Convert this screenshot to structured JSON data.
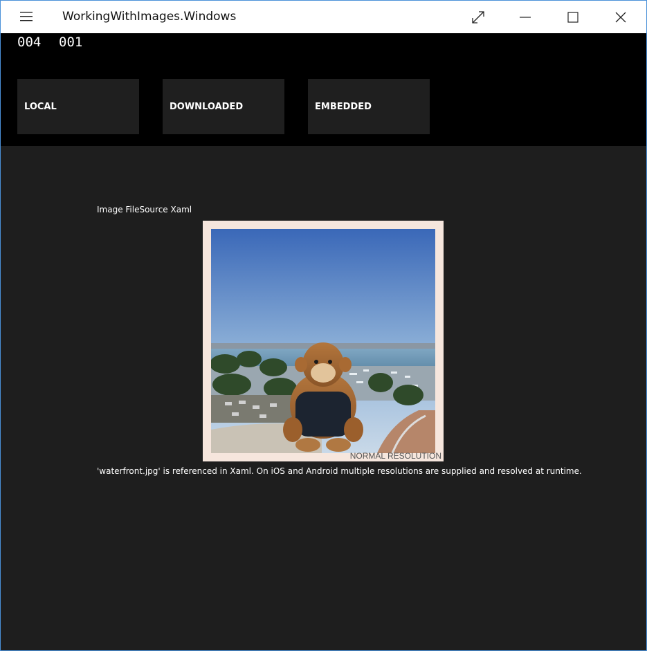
{
  "window": {
    "title": "WorkingWithImages.Windows",
    "accent_color": "#4a90d9"
  },
  "titlebar": {
    "menu_icon": "hamburger-icon",
    "buttons": {
      "fullscreen_icon": "expand-diagonal-icon",
      "minimize_icon": "minimize-icon",
      "maximize_icon": "maximize-icon",
      "close_icon": "close-icon"
    }
  },
  "header": {
    "background_color": "#000000",
    "counters": [
      "004",
      "001"
    ],
    "tabs": [
      {
        "label": "LOCAL"
      },
      {
        "label": "DOWNLOADED"
      },
      {
        "label": "EMBEDDED"
      }
    ]
  },
  "content": {
    "background_color": "#1e1e1e",
    "heading": "Image FileSource Xaml",
    "image_overlay_text": "NORMAL RESOLUTION",
    "caption": "'waterfront.jpg' is referenced in Xaml. On iOS and Android multiple resolutions are supplied and resolved at runtime."
  }
}
